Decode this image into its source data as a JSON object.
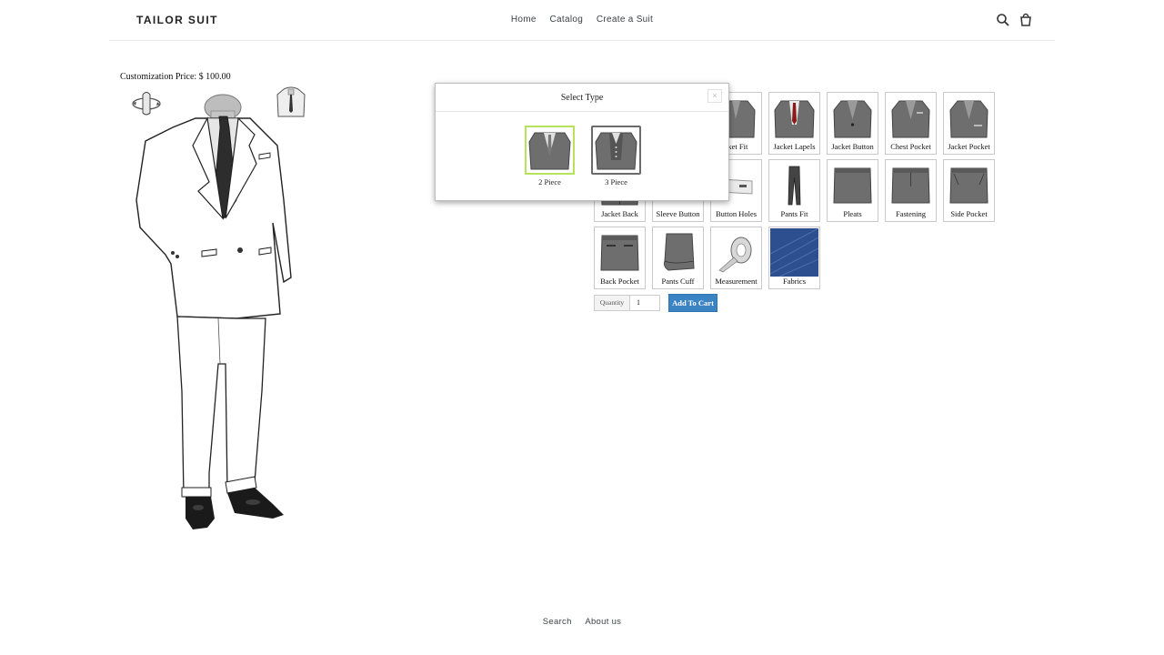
{
  "header": {
    "logo": "TAILOR SUIT",
    "nav": [
      "Home",
      "Catalog",
      "Create a Suit"
    ],
    "icons": [
      "search-icon",
      "cart-icon"
    ]
  },
  "preview": {
    "price_text": "Customization Price: $ 100.00"
  },
  "options": {
    "row1": [
      "Jacket Fit",
      "Jacket Lapels",
      "Jacket Button",
      "Chest Pocket",
      "Jacket Pocket"
    ],
    "row1_visible_first": "cket Fit",
    "row2": [
      "Jacket Back",
      "Sleeve Button",
      "Button Holes",
      "Pants Fit",
      "Pleats",
      "Fastening",
      "Side Pocket"
    ],
    "row3": [
      "Back Pocket",
      "Pants Cuff",
      "Measurement",
      "Fabrics"
    ]
  },
  "cart": {
    "quantity_label": "Quantity",
    "quantity_value": "1",
    "add_to_cart": "Add To Cart"
  },
  "modal": {
    "title": "Select Type",
    "close": "×",
    "types": [
      "2 Piece",
      "3 Piece"
    ],
    "selected": "2 Piece"
  },
  "footer": {
    "links": [
      "Search",
      "About us"
    ]
  },
  "colors": {
    "accent_blue": "#3b84c4",
    "selected_border": "#b7e35b",
    "fabric_blue": "#2d4f8f",
    "suit_gray": "#6e6e6e"
  }
}
